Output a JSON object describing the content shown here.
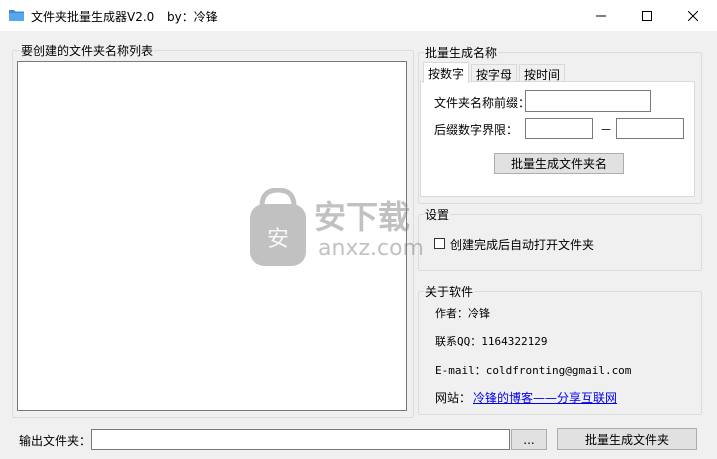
{
  "window": {
    "title": "文件夹批量生成器V2.0",
    "author": "by：冷锋",
    "controls": {
      "minimize": "—",
      "maximize": "☐",
      "close": "✕"
    }
  },
  "list_panel": {
    "title": "要创建的文件夹名称列表"
  },
  "batch_panel": {
    "title": "批量生成名称",
    "tabs": [
      "按数字",
      "按字母",
      "按时间"
    ],
    "prefix_label": "文件夹名称前缀：",
    "range_label": "后缀数字界限：",
    "range_separator": "－",
    "generate_button": "批量生成文件夹名"
  },
  "settings_panel": {
    "title": "设置",
    "auto_open_label": "创建完成后自动打开文件夹"
  },
  "about_panel": {
    "title": "关于软件",
    "author": "作者：冷锋",
    "contact": "联系QQ：1164322129",
    "email": "E-mail：coldfronting@gmail.com",
    "site_label": "网站：",
    "site_link": "冷锋的博客——分享互联网"
  },
  "output": {
    "label": "输出文件夹：",
    "browse_button": "...",
    "generate_button": "批量生成文件夹"
  },
  "watermark": {
    "text_cn": "安下载",
    "text_en": "anxz.com"
  }
}
